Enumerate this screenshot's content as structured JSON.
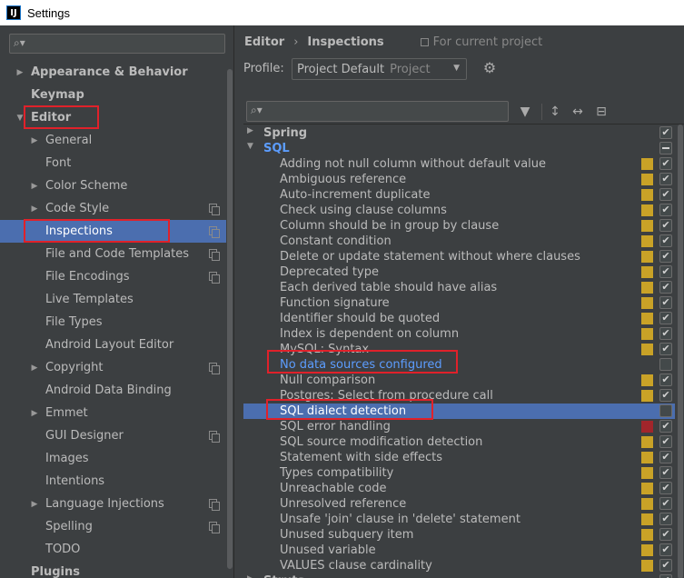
{
  "window": {
    "app_icon": "IJ",
    "title": "Settings"
  },
  "tree": [
    {
      "label": "Appearance & Behavior",
      "level": 0,
      "arrow": "right",
      "bold": true,
      "copy": false
    },
    {
      "label": "Keymap",
      "level": 0,
      "arrow": "",
      "bold": true,
      "copy": false
    },
    {
      "label": "Editor",
      "level": 0,
      "arrow": "down",
      "bold": true,
      "copy": false
    },
    {
      "label": "General",
      "level": 1,
      "arrow": "right",
      "bold": false,
      "copy": false
    },
    {
      "label": "Font",
      "level": 1,
      "arrow": "",
      "bold": false,
      "copy": false
    },
    {
      "label": "Color Scheme",
      "level": 1,
      "arrow": "right",
      "bold": false,
      "copy": false
    },
    {
      "label": "Code Style",
      "level": 1,
      "arrow": "right",
      "bold": false,
      "copy": true
    },
    {
      "label": "Inspections",
      "level": 1,
      "arrow": "",
      "bold": false,
      "copy": true,
      "selected": true
    },
    {
      "label": "File and Code Templates",
      "level": 1,
      "arrow": "",
      "bold": false,
      "copy": true
    },
    {
      "label": "File Encodings",
      "level": 1,
      "arrow": "",
      "bold": false,
      "copy": true
    },
    {
      "label": "Live Templates",
      "level": 1,
      "arrow": "",
      "bold": false,
      "copy": false
    },
    {
      "label": "File Types",
      "level": 1,
      "arrow": "",
      "bold": false,
      "copy": false
    },
    {
      "label": "Android Layout Editor",
      "level": 1,
      "arrow": "",
      "bold": false,
      "copy": false
    },
    {
      "label": "Copyright",
      "level": 1,
      "arrow": "right",
      "bold": false,
      "copy": true
    },
    {
      "label": "Android Data Binding",
      "level": 1,
      "arrow": "",
      "bold": false,
      "copy": false
    },
    {
      "label": "Emmet",
      "level": 1,
      "arrow": "right",
      "bold": false,
      "copy": false
    },
    {
      "label": "GUI Designer",
      "level": 1,
      "arrow": "",
      "bold": false,
      "copy": true
    },
    {
      "label": "Images",
      "level": 1,
      "arrow": "",
      "bold": false,
      "copy": false
    },
    {
      "label": "Intentions",
      "level": 1,
      "arrow": "",
      "bold": false,
      "copy": false
    },
    {
      "label": "Language Injections",
      "level": 1,
      "arrow": "right",
      "bold": false,
      "copy": true
    },
    {
      "label": "Spelling",
      "level": 1,
      "arrow": "",
      "bold": false,
      "copy": true
    },
    {
      "label": "TODO",
      "level": 1,
      "arrow": "",
      "bold": false,
      "copy": false
    },
    {
      "label": "Plugins",
      "level": 0,
      "arrow": "",
      "bold": true,
      "copy": false
    }
  ],
  "breadcrumb": {
    "first": "Editor",
    "separator": "›",
    "second": "Inspections",
    "scope": "For current project"
  },
  "profile": {
    "label": "Profile:",
    "value": "Project Default",
    "sub": "Project"
  },
  "inspections": [
    {
      "label": "Spring",
      "type": "group",
      "arrow": "right",
      "sev": "",
      "check": "checked"
    },
    {
      "label": "SQL",
      "type": "group",
      "arrow": "down",
      "sev": "",
      "check": "mixed",
      "blue": true
    },
    {
      "label": "Adding not null column without default value",
      "type": "item",
      "sev": "#c9a227",
      "check": "checked"
    },
    {
      "label": "Ambiguous reference",
      "type": "item",
      "sev": "#c9a227",
      "check": "checked"
    },
    {
      "label": "Auto-increment duplicate",
      "type": "item",
      "sev": "#c9a227",
      "check": "checked"
    },
    {
      "label": "Check using clause columns",
      "type": "item",
      "sev": "#c9a227",
      "check": "checked"
    },
    {
      "label": "Column should be in group by clause",
      "type": "item",
      "sev": "#c9a227",
      "check": "checked"
    },
    {
      "label": "Constant condition",
      "type": "item",
      "sev": "#c9a227",
      "check": "checked"
    },
    {
      "label": "Delete or update statement without where clauses",
      "type": "item",
      "sev": "#c9a227",
      "check": "checked"
    },
    {
      "label": "Deprecated type",
      "type": "item",
      "sev": "#c9a227",
      "check": "checked"
    },
    {
      "label": "Each derived table should have alias",
      "type": "item",
      "sev": "#c9a227",
      "check": "checked"
    },
    {
      "label": "Function signature",
      "type": "item",
      "sev": "#c9a227",
      "check": "checked"
    },
    {
      "label": "Identifier should be quoted",
      "type": "item",
      "sev": "#c9a227",
      "check": "checked"
    },
    {
      "label": "Index is dependent on column",
      "type": "item",
      "sev": "#c9a227",
      "check": "checked"
    },
    {
      "label": "MySQL: Syntax",
      "type": "item",
      "sev": "#c9a227",
      "check": "checked"
    },
    {
      "label": "No data sources configured",
      "type": "item",
      "sev": "",
      "check": "unchecked",
      "blue": true
    },
    {
      "label": "Null comparison",
      "type": "item",
      "sev": "#c9a227",
      "check": "checked"
    },
    {
      "label": "Postgres: Select from procedure call",
      "type": "item",
      "sev": "#c9a227",
      "check": "checked"
    },
    {
      "label": "SQL dialect detection",
      "type": "item",
      "sev": "",
      "check": "unchecked",
      "selected": true
    },
    {
      "label": "SQL error handling",
      "type": "item",
      "sev": "#a1252b",
      "check": "checked"
    },
    {
      "label": "SQL source modification detection",
      "type": "item",
      "sev": "#c9a227",
      "check": "checked"
    },
    {
      "label": "Statement with side effects",
      "type": "item",
      "sev": "#c9a227",
      "check": "checked"
    },
    {
      "label": "Types compatibility",
      "type": "item",
      "sev": "#c9a227",
      "check": "checked"
    },
    {
      "label": "Unreachable code",
      "type": "item",
      "sev": "#c9a227",
      "check": "checked"
    },
    {
      "label": "Unresolved reference",
      "type": "item",
      "sev": "#c9a227",
      "check": "checked"
    },
    {
      "label": "Unsafe 'join' clause in 'delete' statement",
      "type": "item",
      "sev": "#c9a227",
      "check": "checked"
    },
    {
      "label": "Unused subquery item",
      "type": "item",
      "sev": "#c9a227",
      "check": "checked"
    },
    {
      "label": "Unused variable",
      "type": "item",
      "sev": "#c9a227",
      "check": "checked"
    },
    {
      "label": "VALUES clause cardinality",
      "type": "item",
      "sev": "#c9a227",
      "check": "checked"
    },
    {
      "label": "Struts",
      "type": "group",
      "arrow": "right",
      "sev": "",
      "check": "checked"
    }
  ],
  "colors": {
    "selection": "#4b6eaf",
    "warning": "#c9a227",
    "error": "#a1252b",
    "annotation": "#e0212a",
    "link_blue": "#5c9dff"
  }
}
